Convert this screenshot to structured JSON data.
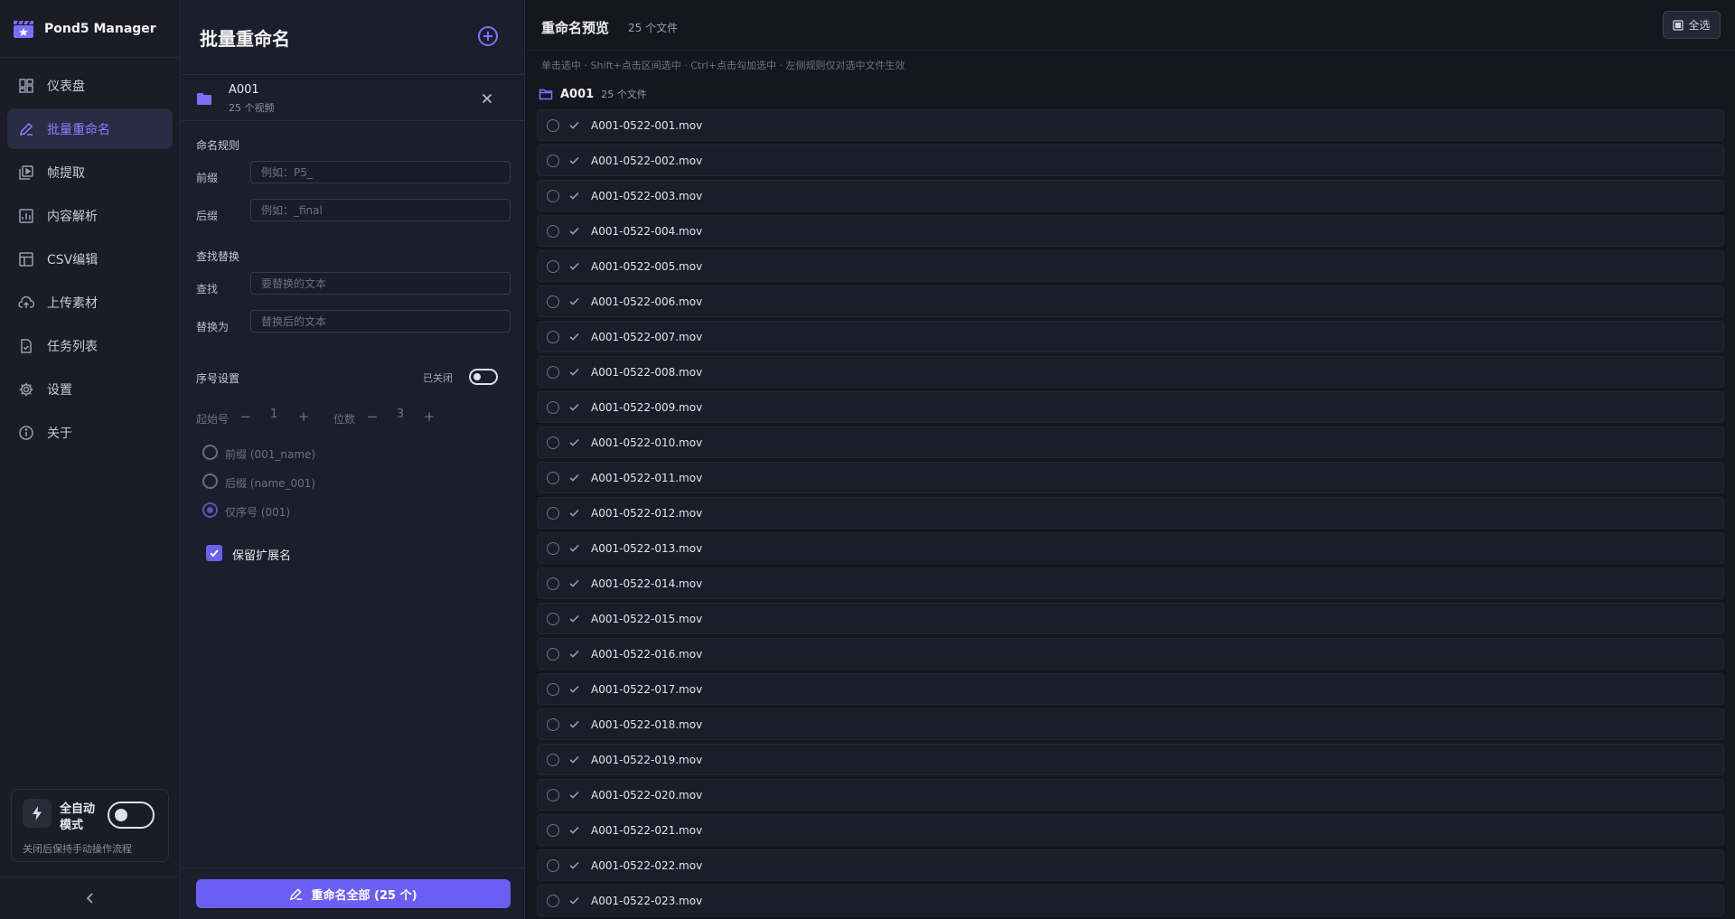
{
  "app": {
    "name": "Pond5 Manager"
  },
  "sidebar": {
    "items": [
      {
        "label": "仪表盘",
        "icon": "dashboard-icon",
        "active": false
      },
      {
        "label": "批量重命名",
        "icon": "rename-pen-icon",
        "active": true
      },
      {
        "label": "帧提取",
        "icon": "frames-icon",
        "active": false
      },
      {
        "label": "内容解析",
        "icon": "analysis-icon",
        "active": false
      },
      {
        "label": "CSV编辑",
        "icon": "table-icon",
        "active": false
      },
      {
        "label": "上传素材",
        "icon": "cloud-upload-icon",
        "active": false
      },
      {
        "label": "任务列表",
        "icon": "task-list-icon",
        "active": false
      },
      {
        "label": "设置",
        "icon": "gear-icon",
        "active": false
      },
      {
        "label": "关于",
        "icon": "info-icon",
        "active": false
      }
    ],
    "auto_mode": {
      "label": "全自动模式",
      "enabled": false,
      "hint": "关闭后保持手动操作流程"
    }
  },
  "panel": {
    "title": "批量重命名",
    "folder": {
      "name": "A001",
      "subtitle": "25 个视频"
    },
    "naming_rules": {
      "section": "命名规则",
      "prefix_label": "前缀",
      "prefix_placeholder": "例如：P5_",
      "prefix_value": "",
      "suffix_label": "后缀",
      "suffix_placeholder": "例如：_final",
      "suffix_value": ""
    },
    "find_replace": {
      "section": "查找替换",
      "find_label": "查找",
      "find_placeholder": "要替换的文本",
      "find_value": "",
      "replace_label": "替换为",
      "replace_placeholder": "替换后的文本",
      "replace_value": ""
    },
    "sequence": {
      "section": "序号设置",
      "toggle_label": "已关闭",
      "enabled": false,
      "start_label": "起始号",
      "start_value": "1",
      "digits_label": "位数",
      "digits_value": "3",
      "minus": "−",
      "plus": "+",
      "options": [
        {
          "label": "前缀 (001_name)",
          "selected": false
        },
        {
          "label": "后缀 (name_001)",
          "selected": false
        },
        {
          "label": "仅序号 (001)",
          "selected": true
        }
      ]
    },
    "keep_extension": {
      "label": "保留扩展名",
      "checked": true
    },
    "rename_button": "重命名全部 (25 个)"
  },
  "preview": {
    "title": "重命名预览",
    "count": "25 个文件",
    "select_all": "全选",
    "hint": "单击选中 · Shift+点击区间选中 · Ctrl+点击勾加选中 · 左侧规则仅对选中文件生效",
    "group": {
      "name": "A001",
      "count": "25 个文件"
    },
    "files": [
      "A001-0522-001.mov",
      "A001-0522-002.mov",
      "A001-0522-003.mov",
      "A001-0522-004.mov",
      "A001-0522-005.mov",
      "A001-0522-006.mov",
      "A001-0522-007.mov",
      "A001-0522-008.mov",
      "A001-0522-009.mov",
      "A001-0522-010.mov",
      "A001-0522-011.mov",
      "A001-0522-012.mov",
      "A001-0522-013.mov",
      "A001-0522-014.mov",
      "A001-0522-015.mov",
      "A001-0522-016.mov",
      "A001-0522-017.mov",
      "A001-0522-018.mov",
      "A001-0522-019.mov",
      "A001-0522-020.mov",
      "A001-0522-021.mov",
      "A001-0522-022.mov",
      "A001-0522-023.mov"
    ]
  },
  "colors": {
    "accent": "#6b5ef5",
    "accent_text": "#8b80ff",
    "background": "#15161e",
    "sidebar": "#1b1c26"
  }
}
